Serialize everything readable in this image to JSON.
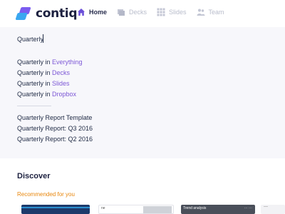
{
  "app": {
    "logo_text": "contiq"
  },
  "nav": {
    "items": [
      {
        "label": "Home",
        "icon": "home-icon",
        "active": true
      },
      {
        "label": "Decks",
        "icon": "decks-icon",
        "active": false
      },
      {
        "label": "Slides",
        "icon": "slides-icon",
        "active": false
      },
      {
        "label": "Team",
        "icon": "team-icon",
        "active": false
      }
    ]
  },
  "search": {
    "value": "Quarterly",
    "scope_suggestions": [
      {
        "prefix": "Quarterly in ",
        "scope": "Everything"
      },
      {
        "prefix": "Quarterly in ",
        "scope": "Decks"
      },
      {
        "prefix": "Quarterly in ",
        "scope": "Slides"
      },
      {
        "prefix": "Quarterly in ",
        "scope": "Dropbox"
      }
    ],
    "results": [
      "Quarterly Report Template",
      "Quarterly Report: Q3 2016",
      "Quarterly Report: Q2 2016"
    ]
  },
  "discover": {
    "title": "Discover",
    "recommended_label": "Recommended for you",
    "thumbnails": [
      {
        "label": ""
      },
      {
        "label": "ne"
      },
      {
        "label": "Trend analysis",
        "extra": "⋯ ⋯"
      },
      {
        "label": "—"
      }
    ]
  },
  "colors": {
    "accent_purple": "#7d58d6",
    "recommended_orange": "#e8870d",
    "logo_purple": "#7b5cf0",
    "logo_blue": "#3aa7f0"
  }
}
